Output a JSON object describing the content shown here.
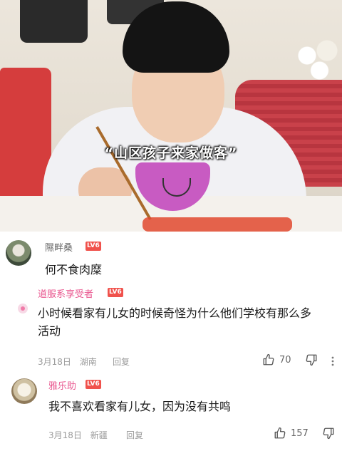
{
  "video": {
    "caption": "“山区孩子来家做客”"
  },
  "comments": [
    {
      "username": "隰畔桑",
      "level": "LV6",
      "text": "何不食肉糜"
    },
    {
      "username": "道服系享受者",
      "level": "LV6",
      "text_line1": "小时候看家有儿女的时候奇怪为什么他们学校有那么多",
      "text_line2": "活动",
      "date": "3月18日",
      "location": "湖南",
      "reply_label": "回复",
      "likes": "70"
    },
    {
      "username": "雅乐助",
      "level": "LV6",
      "text": "我不喜欢看家有儿女，因为没有共鸣",
      "date": "3月18日",
      "location": "新疆",
      "reply_label": "回复",
      "likes": "157"
    }
  ],
  "colors": {
    "username_pink": "#e9578f",
    "username_gray": "#666666",
    "level_badge": "#f0524c",
    "meta_gray": "#9b9b9b"
  },
  "icons": [
    "thumbs-up-icon",
    "thumbs-down-icon",
    "reply-indicator-icon"
  ]
}
